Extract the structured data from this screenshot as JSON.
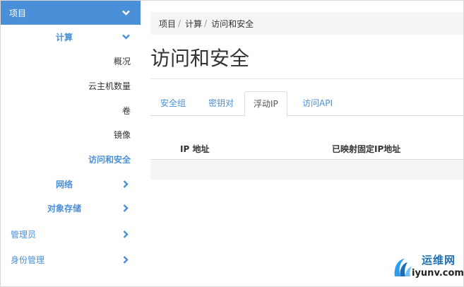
{
  "sidebar": {
    "project": {
      "label": "项目"
    },
    "compute": {
      "label": "计算"
    },
    "compute_items": [
      {
        "label": "概况"
      },
      {
        "label": "云主机数量"
      },
      {
        "label": "卷"
      },
      {
        "label": "镜像"
      },
      {
        "label": "访问和安全",
        "active": true
      }
    ],
    "network": {
      "label": "网络"
    },
    "object_storage": {
      "label": "对象存储"
    },
    "admin": {
      "label": "管理员"
    },
    "identity": {
      "label": "身份管理"
    }
  },
  "breadcrumb": {
    "items": [
      "项目",
      "计算",
      "访问和安全"
    ],
    "separator": "/"
  },
  "page": {
    "title": "访问和安全"
  },
  "tabs": [
    {
      "label": "安全组"
    },
    {
      "label": "密钥对"
    },
    {
      "label": "浮动IP",
      "active": true
    },
    {
      "label": "访问API"
    }
  ],
  "table": {
    "columns": [
      "IP 地址",
      "已映射固定IP地址"
    ]
  },
  "watermark": {
    "name": "运维网",
    "domain": "iyunv.com"
  },
  "colors": {
    "accent": "#4a90d9",
    "text": "#333333",
    "muted_bg": "#f5f5f5"
  }
}
